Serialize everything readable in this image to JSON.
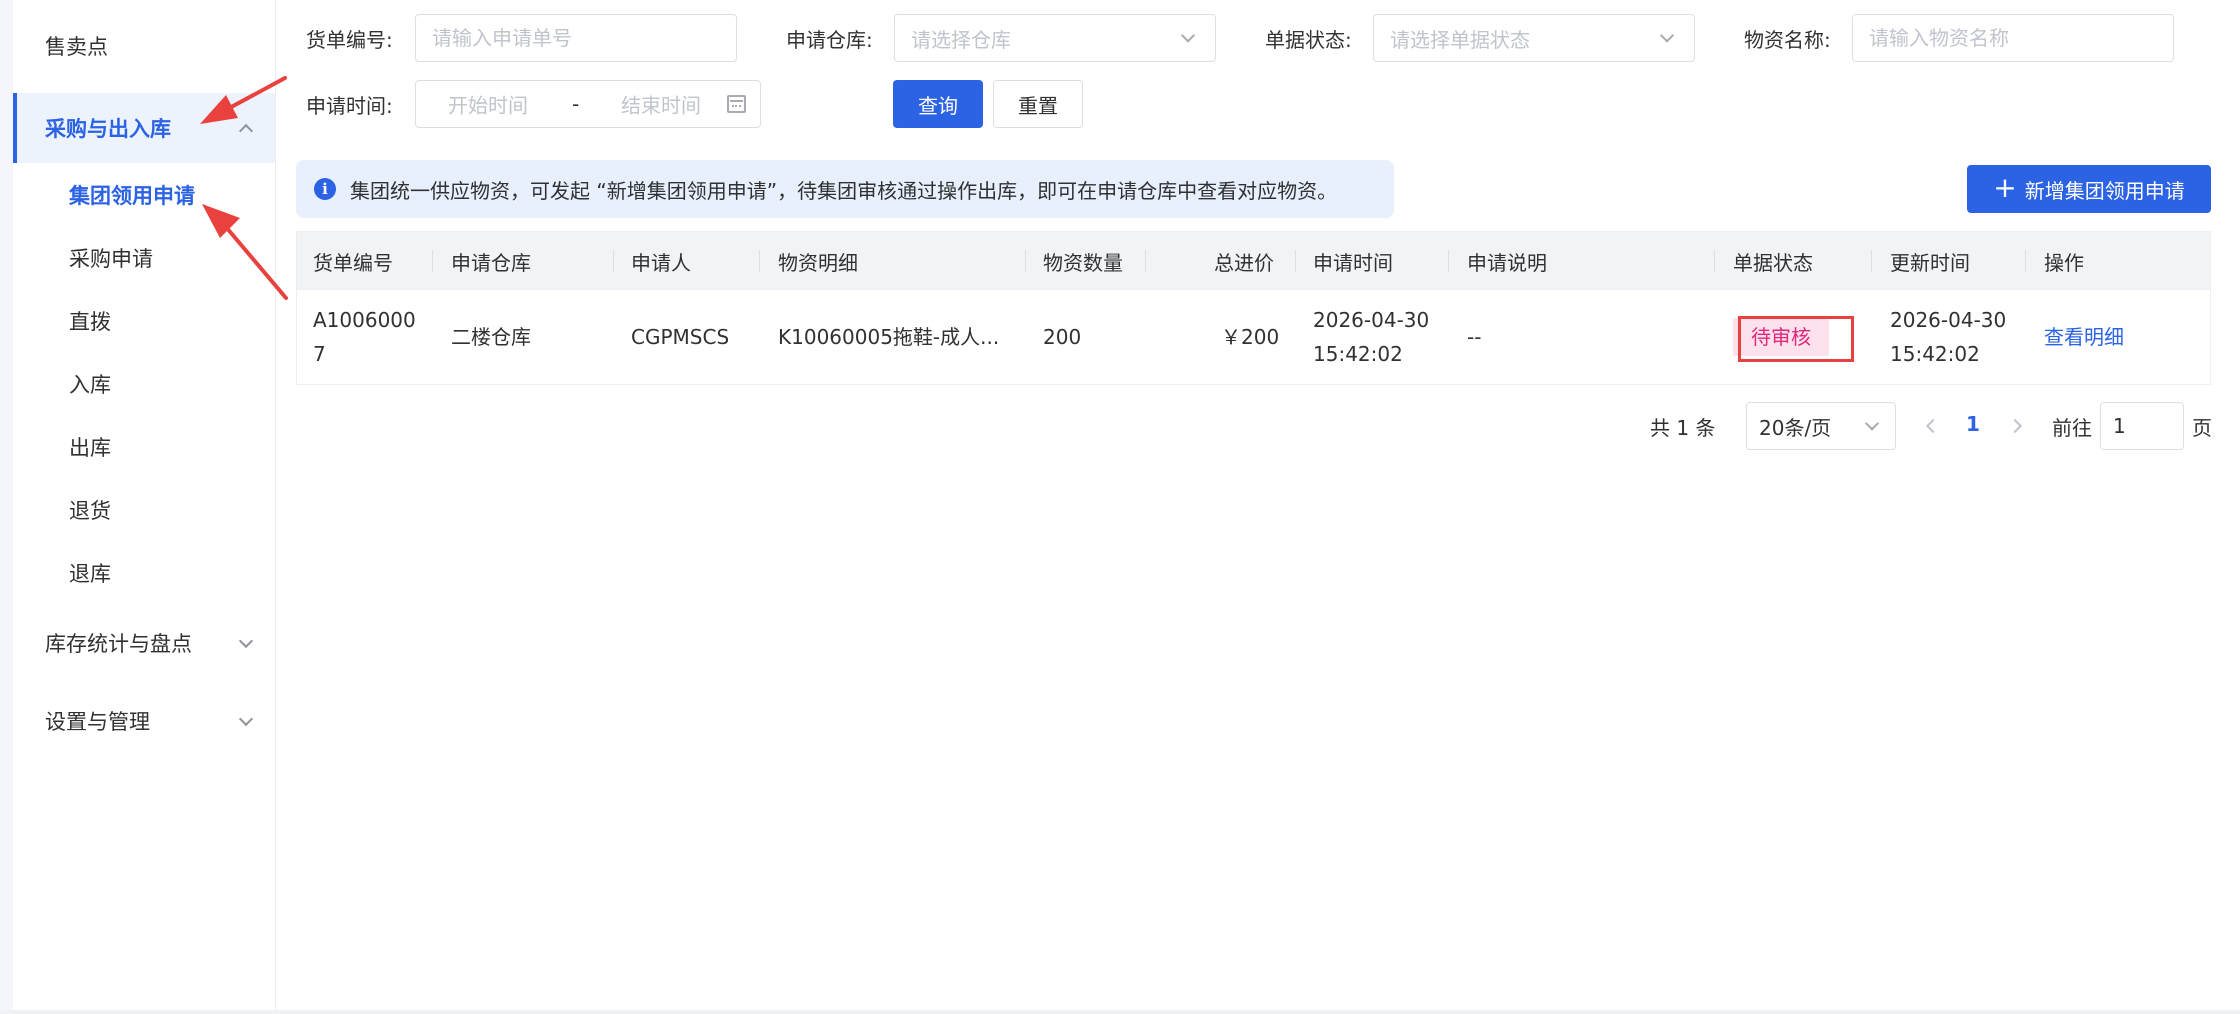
{
  "sidebar": {
    "items": [
      {
        "label": "售卖点"
      },
      {
        "label": "采购与出入库"
      },
      {
        "label": "集团领用申请"
      },
      {
        "label": "采购申请"
      },
      {
        "label": "直拨"
      },
      {
        "label": "入库"
      },
      {
        "label": "出库"
      },
      {
        "label": "退货"
      },
      {
        "label": "退库"
      },
      {
        "label": "库存统计与盘点"
      },
      {
        "label": "设置与管理"
      }
    ]
  },
  "filters": {
    "order_no": {
      "label": "货单编号:",
      "placeholder": "请输入申请单号"
    },
    "warehouse": {
      "label": "申请仓库:",
      "placeholder": "请选择仓库"
    },
    "status": {
      "label": "单据状态:",
      "placeholder": "请选择单据状态"
    },
    "material": {
      "label": "物资名称:",
      "placeholder": "请输入物资名称"
    },
    "time": {
      "label": "申请时间:",
      "start_placeholder": "开始时间",
      "separator": "-",
      "end_placeholder": "结束时间"
    },
    "search_label": "查询",
    "reset_label": "重置"
  },
  "notice": {
    "text": "集团统一供应物资，可发起 “新增集团领用申请”，待集团审核通过操作出库，即可在申请仓库中查看对应物资。"
  },
  "add_button": {
    "plus": "+",
    "label": "新增集团领用申请"
  },
  "table": {
    "headers": [
      "货单编号",
      "申请仓库",
      "申请人",
      "物资明细",
      "物资数量",
      "总进价",
      "申请时间",
      "申请说明",
      "单据状态",
      "更新时间",
      "操作"
    ],
    "rows": [
      {
        "order_no_line1": "A1006000",
        "order_no_line2": "7",
        "warehouse": "二楼仓库",
        "applicant": "CGPMSCS",
        "detail": "K10060005拖鞋-成人...",
        "quantity": "200",
        "total": "￥200",
        "apply_date": "2026-04-30",
        "apply_time": "15:42:02",
        "remark": "--",
        "status": "待审核",
        "update_date": "2026-04-30",
        "update_time": "15:42:02",
        "action": "查看明细"
      }
    ]
  },
  "pagination": {
    "total": "共 1 条",
    "page_size": "20条/页",
    "current": "1",
    "goto_label": "前往",
    "goto_value": "1",
    "page_suffix": "页"
  },
  "colors": {
    "primary": "#2b63e4",
    "status_pending_bg": "#fde2ee",
    "status_pending_fg": "#e0287a",
    "annotation_red": "#e8413e"
  }
}
